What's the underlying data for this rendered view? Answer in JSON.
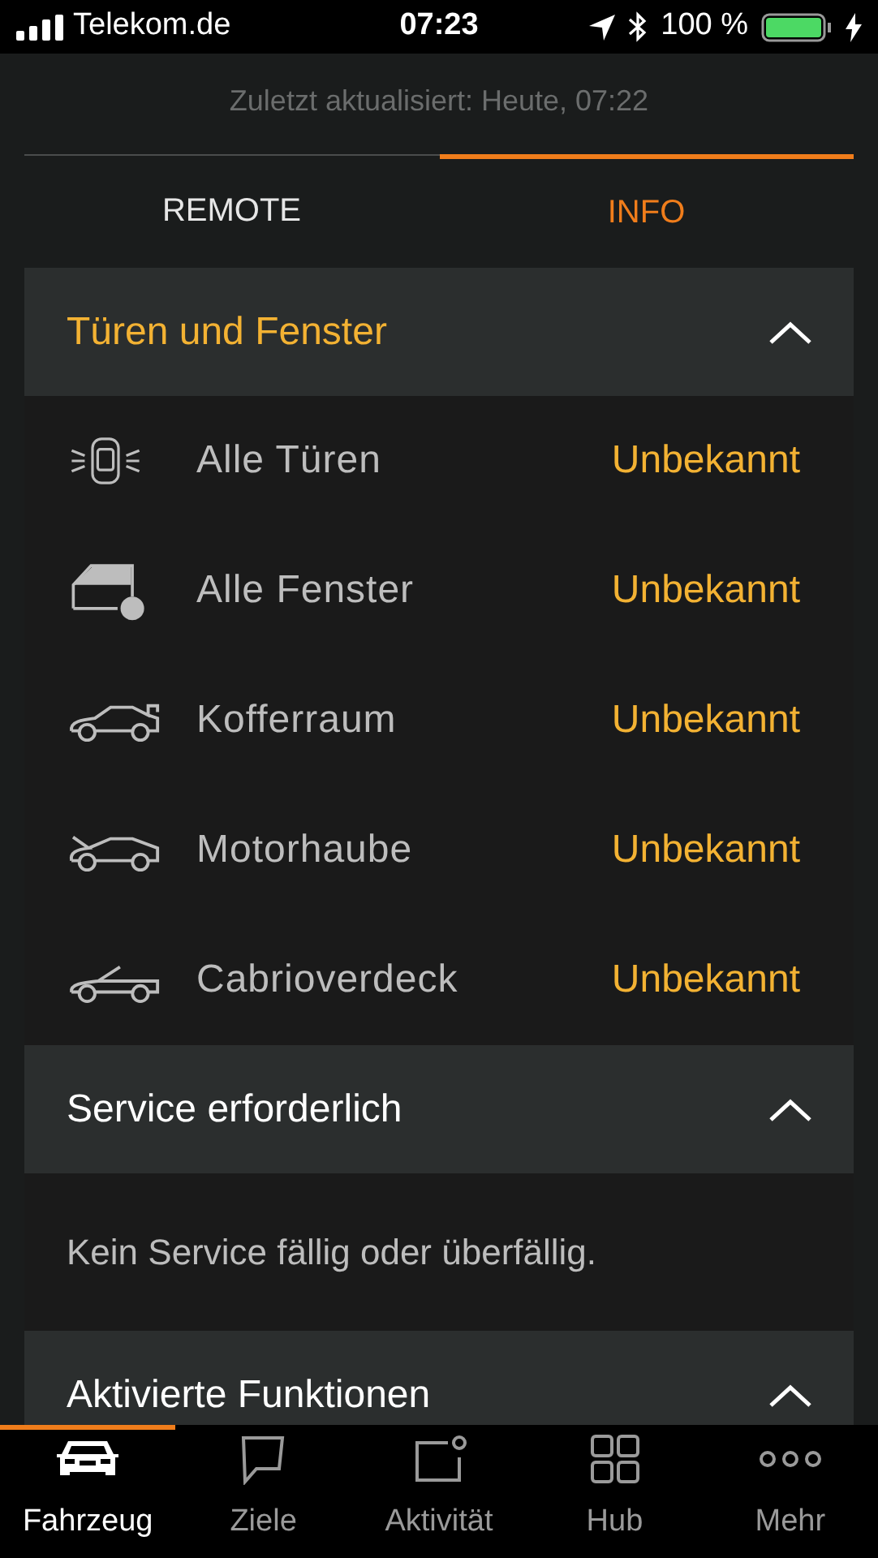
{
  "status_bar": {
    "carrier": "Telekom.de",
    "time": "07:23",
    "battery": "100 %"
  },
  "last_updated": "Zuletzt aktualisiert: Heute, 07:22",
  "tabs": [
    {
      "label": "REMOTE",
      "selected": false
    },
    {
      "label": "INFO",
      "selected": true
    }
  ],
  "sections": [
    {
      "title": "Türen und Fenster",
      "expanded": true,
      "kind": "list",
      "items": [
        {
          "kind": "doors",
          "label": "Alle Türen",
          "value": "Unbekannt"
        },
        {
          "kind": "windows",
          "label": "Alle Fenster",
          "value": "Unbekannt"
        },
        {
          "kind": "trunk",
          "label": "Kofferraum",
          "value": "Unbekannt"
        },
        {
          "kind": "hood",
          "label": "Motorhaube",
          "value": "Unbekannt"
        },
        {
          "kind": "convertible",
          "label": "Cabrioverdeck",
          "value": "Unbekannt"
        }
      ]
    },
    {
      "title": "Service erforderlich",
      "expanded": true,
      "kind": "text",
      "text": "Kein Service fällig oder überfällig."
    },
    {
      "title": "Aktivierte Funktionen",
      "expanded": true,
      "kind": "text"
    }
  ],
  "nav": [
    {
      "kind": "car",
      "label": "Fahrzeug",
      "selected": true
    },
    {
      "kind": "chat",
      "label": "Ziele",
      "selected": false
    },
    {
      "kind": "activity",
      "label": "Aktivität",
      "selected": false
    },
    {
      "kind": "grid",
      "label": "Hub",
      "selected": false
    },
    {
      "kind": "more",
      "label": "Mehr",
      "selected": false
    }
  ]
}
